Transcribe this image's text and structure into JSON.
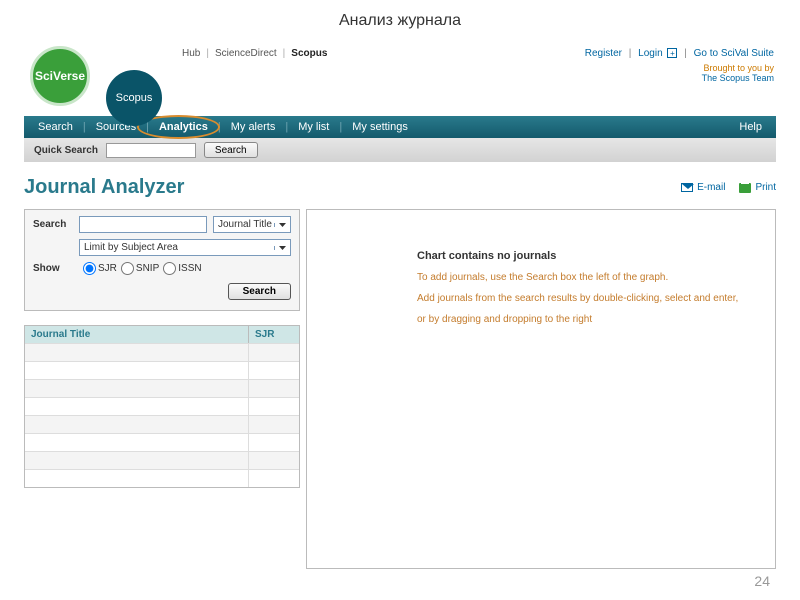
{
  "slide": {
    "title": "Анализ журнала",
    "number": "24"
  },
  "brand": {
    "sciverse": "SciVerse",
    "scopus": "Scopus"
  },
  "topnav": {
    "hub": "Hub",
    "sciencedirect": "ScienceDirect",
    "scopus": "Scopus"
  },
  "rightlinks": {
    "register": "Register",
    "login": "Login",
    "scival": "Go to SciVal Suite",
    "brought": "Brought to you by",
    "team": "The Scopus Team"
  },
  "mainnav": {
    "search": "Search",
    "sources": "Sources",
    "analytics": "Analytics",
    "myalerts": "My alerts",
    "mylist": "My list",
    "mysettings": "My settings",
    "help": "Help"
  },
  "quicksearch": {
    "label": "Quick Search",
    "button": "Search"
  },
  "page": {
    "title": "Journal Analyzer",
    "email": "E-mail",
    "print": "Print"
  },
  "searchpanel": {
    "search_label": "Search",
    "journaltitle_dd": "Journal Title",
    "limit_subject": "Limit by Subject Area",
    "show_label": "Show",
    "sjr": "SJR",
    "snip": "SNIP",
    "issn": "ISSN",
    "button": "Search"
  },
  "table": {
    "col1": "Journal Title",
    "col2": "SJR"
  },
  "empty": {
    "heading": "Chart contains no journals",
    "line1": "To add journals, use the Search box the left of the graph.",
    "line2": "Add journals from the search results by double-clicking, select and enter,",
    "line3": "or by dragging and dropping to the right"
  }
}
